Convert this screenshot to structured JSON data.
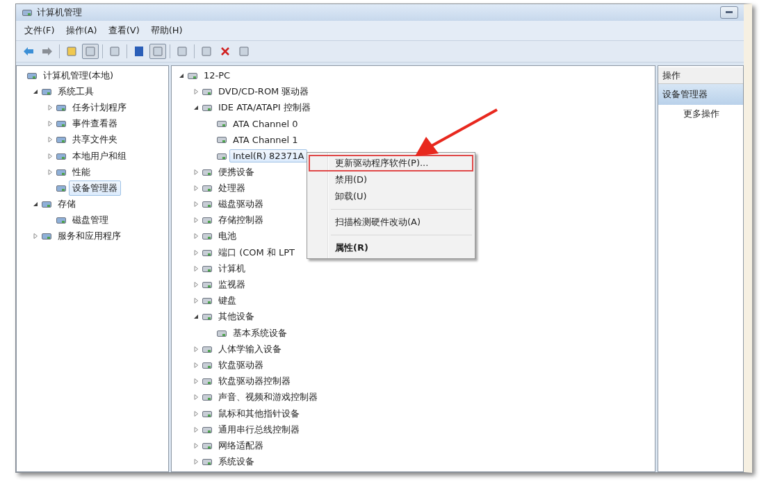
{
  "window": {
    "title": "计算机管理"
  },
  "menu": [
    {
      "label": "文件(F)"
    },
    {
      "label": "操作(A)"
    },
    {
      "label": "查看(V)"
    },
    {
      "label": "帮助(H)"
    }
  ],
  "left_tree": [
    {
      "label": "计算机管理(本地)",
      "selected": false,
      "children": [
        {
          "label": "系统工具",
          "expanded": true,
          "selected": false,
          "children": [
            {
              "label": "任务计划程序",
              "expanded": false,
              "selected": false
            },
            {
              "label": "事件查看器",
              "expanded": false,
              "selected": false
            },
            {
              "label": "共享文件夹",
              "expanded": false,
              "selected": false
            },
            {
              "label": "本地用户和组",
              "expanded": false,
              "selected": false
            },
            {
              "label": "性能",
              "expanded": false,
              "selected": false
            },
            {
              "label": "设备管理器",
              "selected": true
            }
          ]
        },
        {
          "label": "存储",
          "expanded": true,
          "selected": false,
          "children": [
            {
              "label": "磁盘管理",
              "selected": false
            }
          ]
        },
        {
          "label": "服务和应用程序",
          "expanded": false,
          "selected": false
        }
      ]
    }
  ],
  "device_tree": [
    {
      "label": "12-PC",
      "expanded": true,
      "selected": false,
      "children": [
        {
          "label": "DVD/CD-ROM 驱动器",
          "expanded": false,
          "selected": false
        },
        {
          "label": "IDE ATA/ATAPI 控制器",
          "expanded": true,
          "selected": false,
          "children": [
            {
              "label": "ATA Channel 0",
              "selected": false
            },
            {
              "label": "ATA Channel 1",
              "selected": false
            },
            {
              "label": "Intel(R) 82371A",
              "selected": true
            }
          ]
        },
        {
          "label": "便携设备",
          "expanded": false,
          "selected": false
        },
        {
          "label": "处理器",
          "expanded": false,
          "selected": false
        },
        {
          "label": "磁盘驱动器",
          "expanded": false,
          "selected": false
        },
        {
          "label": "存储控制器",
          "expanded": false,
          "selected": false
        },
        {
          "label": "电池",
          "expanded": false,
          "selected": false
        },
        {
          "label": "端口 (COM 和 LPT",
          "expanded": false,
          "selected": false
        },
        {
          "label": "计算机",
          "expanded": false,
          "selected": false
        },
        {
          "label": "监视器",
          "expanded": false,
          "selected": false
        },
        {
          "label": "键盘",
          "expanded": false,
          "selected": false
        },
        {
          "label": "其他设备",
          "expanded": true,
          "selected": false,
          "children": [
            {
              "label": "基本系统设备",
              "selected": false
            }
          ]
        },
        {
          "label": "人体学输入设备",
          "expanded": false,
          "selected": false
        },
        {
          "label": "软盘驱动器",
          "expanded": false,
          "selected": false
        },
        {
          "label": "软盘驱动器控制器",
          "expanded": false,
          "selected": false
        },
        {
          "label": "声音、视频和游戏控制器",
          "expanded": false,
          "selected": false
        },
        {
          "label": "鼠标和其他指针设备",
          "expanded": false,
          "selected": false
        },
        {
          "label": "通用串行总线控制器",
          "expanded": false,
          "selected": false
        },
        {
          "label": "网络适配器",
          "expanded": false,
          "selected": false
        },
        {
          "label": "系统设备",
          "expanded": false,
          "selected": false
        }
      ]
    }
  ],
  "context_menu": [
    {
      "kind": "item",
      "label": "更新驱动程序软件(P)...",
      "highlighted": true,
      "default": false
    },
    {
      "kind": "item",
      "label": "禁用(D)",
      "highlighted": false,
      "default": false
    },
    {
      "kind": "item",
      "label": "卸载(U)",
      "highlighted": false,
      "default": false
    },
    {
      "kind": "separator"
    },
    {
      "kind": "item",
      "label": "扫描检测硬件改动(A)",
      "highlighted": false,
      "default": false
    },
    {
      "kind": "separator"
    },
    {
      "kind": "item",
      "label": "属性(R)",
      "highlighted": false,
      "default": true
    }
  ],
  "actions_pane": {
    "header": "操作",
    "sections": [
      {
        "label": "设备管理器",
        "selected": true
      }
    ],
    "items": [
      {
        "label": "更多操作"
      }
    ]
  }
}
